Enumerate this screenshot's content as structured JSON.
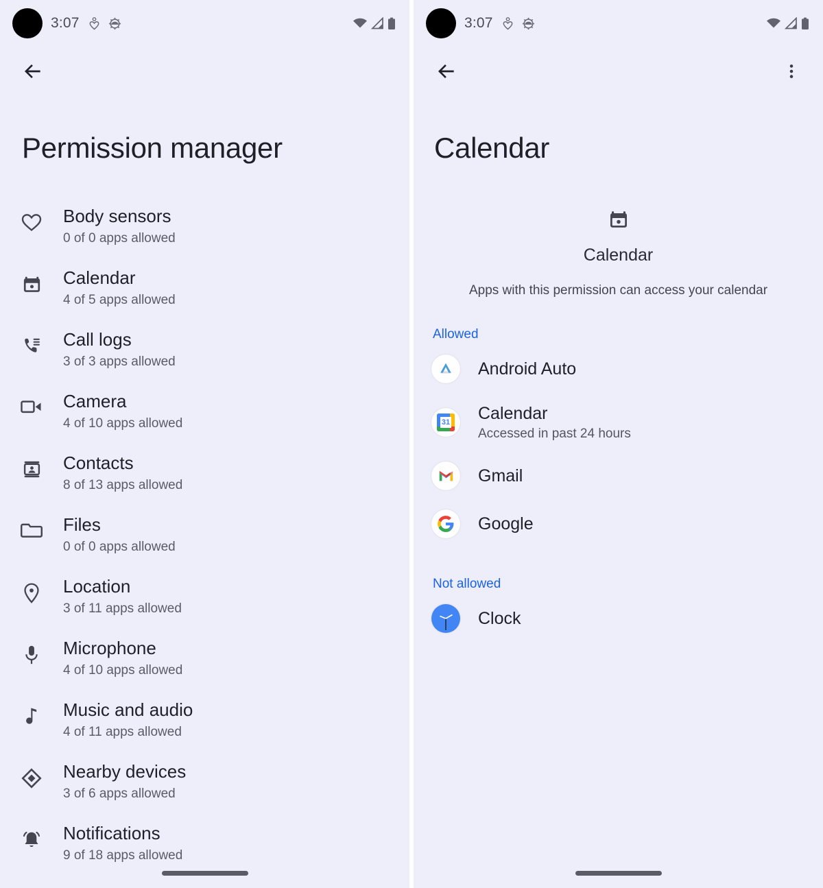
{
  "theme": {
    "background": "#eeedfa",
    "text_primary": "#1f1f28",
    "text_secondary": "#5b5b66",
    "accent_blue": "#1a63e8"
  },
  "status_bar": {
    "time": "3:07",
    "icons": [
      "camera-cutout",
      "heart-status-icon",
      "gear-status-icon",
      "wifi-icon",
      "signal-icon",
      "battery-icon"
    ]
  },
  "left_panel": {
    "app_bar": {
      "back_icon": "arrow-back-icon"
    },
    "title": "Permission manager",
    "permissions": [
      {
        "icon": "heart-icon",
        "name": "Body sensors",
        "subtitle": "0 of 0 apps allowed"
      },
      {
        "icon": "calendar-icon",
        "name": "Calendar",
        "subtitle": "4 of 5 apps allowed"
      },
      {
        "icon": "call-log-icon",
        "name": "Call logs",
        "subtitle": "3 of 3 apps allowed"
      },
      {
        "icon": "video-camera-icon",
        "name": "Camera",
        "subtitle": "4 of 10 apps allowed"
      },
      {
        "icon": "contacts-icon",
        "name": "Contacts",
        "subtitle": "8 of 13 apps allowed"
      },
      {
        "icon": "folder-icon",
        "name": "Files",
        "subtitle": "0 of 0 apps allowed"
      },
      {
        "icon": "location-pin-icon",
        "name": "Location",
        "subtitle": "3 of 11 apps allowed"
      },
      {
        "icon": "microphone-icon",
        "name": "Microphone",
        "subtitle": "4 of 10 apps allowed"
      },
      {
        "icon": "music-note-icon",
        "name": "Music and audio",
        "subtitle": "4 of 11 apps allowed"
      },
      {
        "icon": "nearby-icon",
        "name": "Nearby devices",
        "subtitle": "3 of 6 apps allowed"
      },
      {
        "icon": "bell-icon",
        "name": "Notifications",
        "subtitle": "9 of 18 apps allowed"
      }
    ]
  },
  "right_panel": {
    "app_bar": {
      "back_icon": "arrow-back-icon",
      "overflow_icon": "more-vert-icon"
    },
    "title": "Calendar",
    "hero": {
      "icon": "calendar-icon",
      "name": "Calendar",
      "description": "Apps with this permission can access your calendar"
    },
    "sections": [
      {
        "label": "Allowed",
        "apps": [
          {
            "icon": "android-auto-icon",
            "name": "Android Auto",
            "subtitle": ""
          },
          {
            "icon": "google-calendar-icon",
            "name": "Calendar",
            "subtitle": "Accessed in past 24 hours"
          },
          {
            "icon": "gmail-icon",
            "name": "Gmail",
            "subtitle": ""
          },
          {
            "icon": "google-icon",
            "name": "Google",
            "subtitle": ""
          }
        ]
      },
      {
        "label": "Not allowed",
        "apps": [
          {
            "icon": "clock-icon",
            "name": "Clock",
            "subtitle": ""
          }
        ]
      }
    ]
  },
  "nav_bar": {
    "gesture_pill": "home-gesture-pill"
  }
}
